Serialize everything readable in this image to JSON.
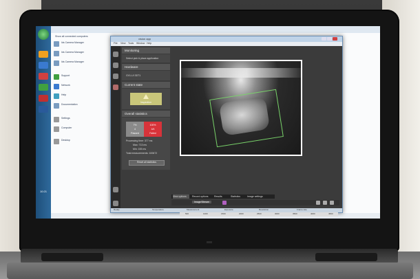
{
  "explorer": {
    "toolbar_label": "Show all connected computers",
    "items": [
      {
        "label": "Ids Camera Manager"
      },
      {
        "label": "Ids Camera Manager"
      },
      {
        "label": "Ids Camera Manager"
      },
      {
        "label": "Support"
      },
      {
        "label": "Network"
      },
      {
        "label": "Help"
      },
      {
        "label": "Documentation"
      },
      {
        "label": "Settings"
      },
      {
        "label": "Computer"
      },
      {
        "label": "Desktop"
      }
    ]
  },
  "app": {
    "title": "vision app",
    "menu": [
      "File",
      "View",
      "Tools",
      "Window",
      "Help"
    ],
    "monitoring_label": "Monitoring",
    "application_name": "Select pick & place application",
    "hardware_label": "Hardware",
    "hardware_item": "GV1-UI 3DT1",
    "current_state_label": "Current state",
    "current_state_value": "Inspection",
    "overall_stats_label": "Overall statistics",
    "stats": {
      "pass_percent": "7%",
      "pass_count": "4",
      "pass_label": "Passed",
      "fail_percent": "100%",
      "fail_count": "4/4",
      "fail_label": "Failed"
    },
    "processing_time": "Processing time: 377 ms",
    "max_time": "Max: 713 ms",
    "min_time": "Min: 155 ms",
    "total_measurements": "Total measurements: 100672",
    "reset_label": "Reset all statistics",
    "tabs": [
      "View options",
      "Record options",
      "Results",
      "Statistics",
      "Image settings"
    ],
    "mode_select": "Image/Stream",
    "ruler_ticks": [
      "500",
      "1000",
      "1500",
      "2000",
      "2500",
      "3000",
      "3500",
      "4000",
      "4500"
    ],
    "status_items": [
      "Ready",
      "Temperature",
      "Measurement",
      "Exposure",
      "Resolution",
      "Frame rate"
    ]
  },
  "taskbar": {
    "clock": "10:21"
  }
}
